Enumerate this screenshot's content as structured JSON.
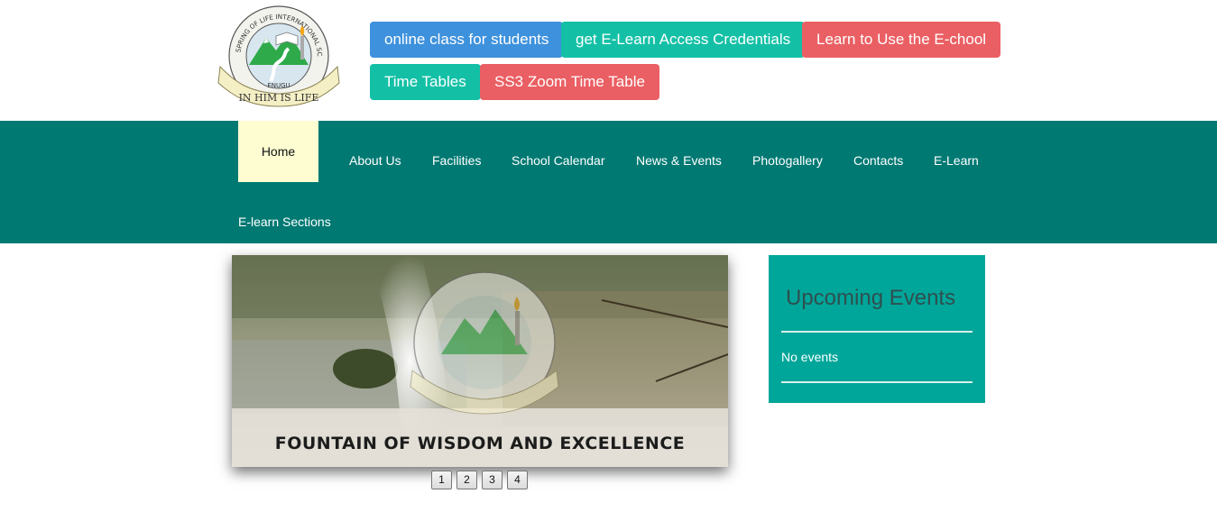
{
  "logo": {
    "ring_text": "SPRING OF LIFE INTERNATIONAL SCHOOLS",
    "city": "ENUGU",
    "motto": "IN HIM IS LIFE"
  },
  "quick_links": [
    {
      "label": "online class for students",
      "color": "#3e91dc"
    },
    {
      "label": "get E-Learn Access Credentials",
      "color": "#13c0a6"
    },
    {
      "label": "Learn to Use the E-chool",
      "color": "#ea5f63"
    },
    {
      "label": "Time Tables",
      "color": "#13c0a6"
    },
    {
      "label": "SS3 Zoom Time Table",
      "color": "#ea5f63"
    }
  ],
  "nav": {
    "active": "Home",
    "items": [
      "Home",
      "About Us",
      "Facilities",
      "School Calendar",
      "News & Events",
      "Photogallery",
      "Contacts",
      "E-Learn",
      "E-learn Sections"
    ]
  },
  "slider": {
    "caption": "FOUNTAIN OF WISDOM AND EXCELLENCE",
    "pages": [
      "1",
      "2",
      "3",
      "4"
    ]
  },
  "events": {
    "title": "Upcoming Events",
    "empty_text": "No events"
  },
  "colors": {
    "nav_bg": "#007973",
    "nav_active_bg": "#fefdd1",
    "events_bg": "#00a69a",
    "button_blue": "#3e91dc",
    "button_teal": "#13c0a6",
    "button_red": "#ea5f63"
  }
}
